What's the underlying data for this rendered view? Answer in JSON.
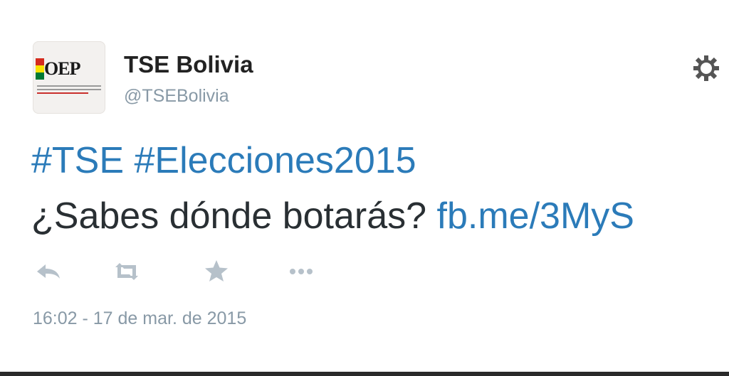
{
  "tweet": {
    "avatar": {
      "logo_text": "OEP",
      "icon": "organizational-logo-icon"
    },
    "display_name": "TSE Bolivia",
    "handle": "@TSEBolivia",
    "settings_icon": "gear-icon",
    "hashtags": [
      "#TSE",
      "#Elecciones2015"
    ],
    "question": "¿Sabes dónde botarás?",
    "link": "fb.me/3MyS",
    "actions": [
      {
        "name": "reply",
        "icon": "reply-icon"
      },
      {
        "name": "retweet",
        "icon": "retweet-icon"
      },
      {
        "name": "favorite",
        "icon": "star-icon"
      },
      {
        "name": "more",
        "icon": "more-icon"
      }
    ],
    "timestamp": "16:02 - 17 de mar. de 2015"
  },
  "colors": {
    "link": "#2b7bb9",
    "text": "#292f33",
    "muted": "#8899a6",
    "icon": "#b6c1ca"
  }
}
